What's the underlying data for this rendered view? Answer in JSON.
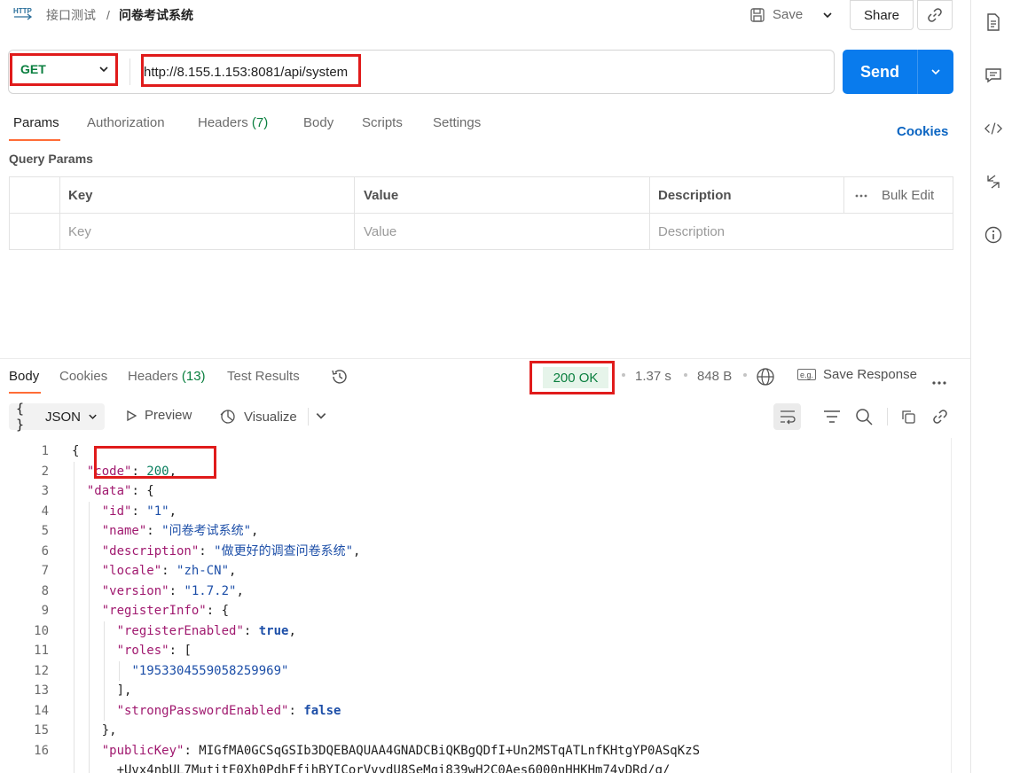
{
  "header": {
    "http_badge": "HTTP",
    "breadcrumb_parent": "接口测试",
    "breadcrumb_sep": "/",
    "breadcrumb_current": "问卷考试系统",
    "save_label": "Save",
    "share_label": "Share"
  },
  "request": {
    "method": "GET",
    "url": "http://8.155.1.153:8081/api/system",
    "send_label": "Send"
  },
  "request_tabs": [
    {
      "label": "Params",
      "count": ""
    },
    {
      "label": "Authorization",
      "count": ""
    },
    {
      "label": "Headers",
      "count": "(7)"
    },
    {
      "label": "Body",
      "count": ""
    },
    {
      "label": "Scripts",
      "count": ""
    },
    {
      "label": "Settings",
      "count": ""
    }
  ],
  "cookies_link": "Cookies",
  "query_params": {
    "title": "Query Params",
    "columns": [
      "Key",
      "Value",
      "Description"
    ],
    "bulk_edit": "Bulk Edit",
    "placeholders": [
      "Key",
      "Value",
      "Description"
    ]
  },
  "response": {
    "tabs": [
      {
        "label": "Body",
        "count": ""
      },
      {
        "label": "Cookies",
        "count": ""
      },
      {
        "label": "Headers",
        "count": "(13)"
      },
      {
        "label": "Test Results",
        "count": ""
      }
    ],
    "status": "200 OK",
    "time": "1.37 s",
    "size": "848 B",
    "save_response": "Save Response",
    "format": "JSON",
    "format_prefix": "{ }",
    "preview": "Preview",
    "visualize": "Visualize"
  },
  "code_lines": [
    {
      "n": "1",
      "t": "{"
    },
    {
      "n": "2",
      "t": "  \"code\": 200,"
    },
    {
      "n": "3",
      "t": "  \"data\": {"
    },
    {
      "n": "4",
      "t": "    \"id\": \"1\","
    },
    {
      "n": "5",
      "t": "    \"name\": \"问卷考试系统\","
    },
    {
      "n": "6",
      "t": "    \"description\": \"做更好的调查问卷系统\","
    },
    {
      "n": "7",
      "t": "    \"locale\": \"zh-CN\","
    },
    {
      "n": "8",
      "t": "    \"version\": \"1.7.2\","
    },
    {
      "n": "9",
      "t": "    \"registerInfo\": {"
    },
    {
      "n": "10",
      "t": "      \"registerEnabled\": true,"
    },
    {
      "n": "11",
      "t": "      \"roles\": ["
    },
    {
      "n": "12",
      "t": "        \"1953304559058259969\""
    },
    {
      "n": "13",
      "t": "      ],"
    },
    {
      "n": "14",
      "t": "      \"strongPasswordEnabled\": false"
    },
    {
      "n": "15",
      "t": "    },"
    },
    {
      "n": "16",
      "t": "    \"publicKey\": \"MIGfMA0GCSqGSIb3DQEBAQUAA4GNADCBiQKBgQDfI+Un2MSTqATLnfKHtgYP0ASqKzS"
    },
    {
      "n": "",
      "t": "      +Uvx4nbUL7MutitE0Xh0PdhFfihBYICorVvvdU8SeMgi839wH2C0Aes6000nHHKHm74vDRd/q/"
    }
  ]
}
